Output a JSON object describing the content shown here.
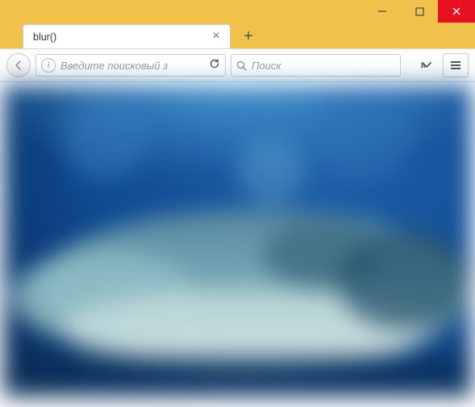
{
  "window": {
    "tab_title": "blur()"
  },
  "toolbar": {
    "url_placeholder": "Введите поисковый з",
    "search_placeholder": "Поиск"
  }
}
